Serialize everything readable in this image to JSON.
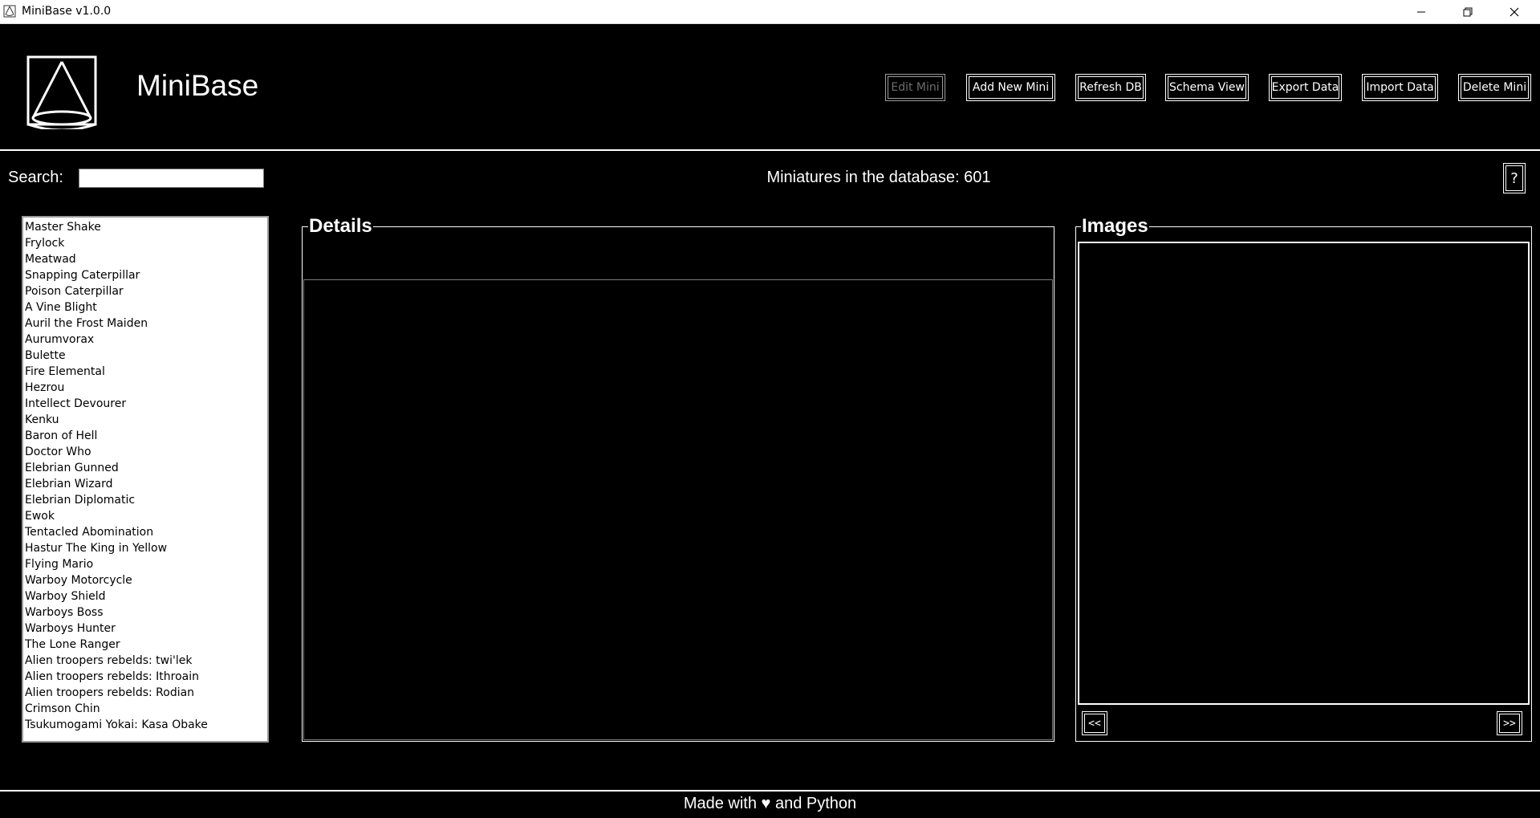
{
  "window": {
    "title": "MiniBase v1.0.0",
    "controls": [
      "minimize-icon",
      "restore-icon",
      "close-icon"
    ]
  },
  "header": {
    "app_name": "MiniBase",
    "logo_icon": "cone-logo-icon",
    "toolbar": {
      "edit_mini": "Edit Mini",
      "add_new_mini": "Add New Mini",
      "refresh_db": "Refresh DB",
      "schema_view": "Schema View",
      "export_data": "Export Data",
      "import_data": "Import Data",
      "delete_mini": "Delete Mini"
    }
  },
  "search": {
    "label": "Search:",
    "value": "",
    "placeholder": ""
  },
  "status": {
    "count_text": "Miniatures in the database: 601"
  },
  "help": {
    "label": "?"
  },
  "mini_list": [
    "Master Shake",
    "Frylock",
    "Meatwad",
    "Snapping Caterpillar",
    "Poison Caterpillar",
    "A Vine Blight",
    "Auril the Frost Maiden",
    "Aurumvorax",
    "Bulette",
    "Fire Elemental",
    "Hezrou",
    "Intellect Devourer",
    "Kenku",
    "Baron of Hell",
    "Doctor Who",
    "Elebrian Gunned",
    "Elebrian Wizard",
    "Elebrian Diplomatic",
    "Ewok",
    "Tentacled Abomination",
    "Hastur The King in Yellow",
    "Flying Mario",
    "Warboy Motorcycle",
    "Warboy Shield",
    "Warboys Boss",
    "Warboys Hunter",
    "The Lone Ranger",
    "Alien troopers rebelds: twi'lek",
    "Alien troopers rebelds: Ithroain",
    "Alien troopers rebelds: Rodian",
    "Crimson Chin",
    "Tsukumogami Yokai: Kasa Obake"
  ],
  "details": {
    "title": "Details"
  },
  "images": {
    "title": "Images",
    "prev_label": "<<",
    "next_label": ">>"
  },
  "footer": {
    "text": "Made with ♥ and Python"
  },
  "colors": {
    "background": "#000000",
    "foreground": "#ffffff",
    "disabled_text": "#6d6d6d",
    "list_background": "#ffffff"
  }
}
